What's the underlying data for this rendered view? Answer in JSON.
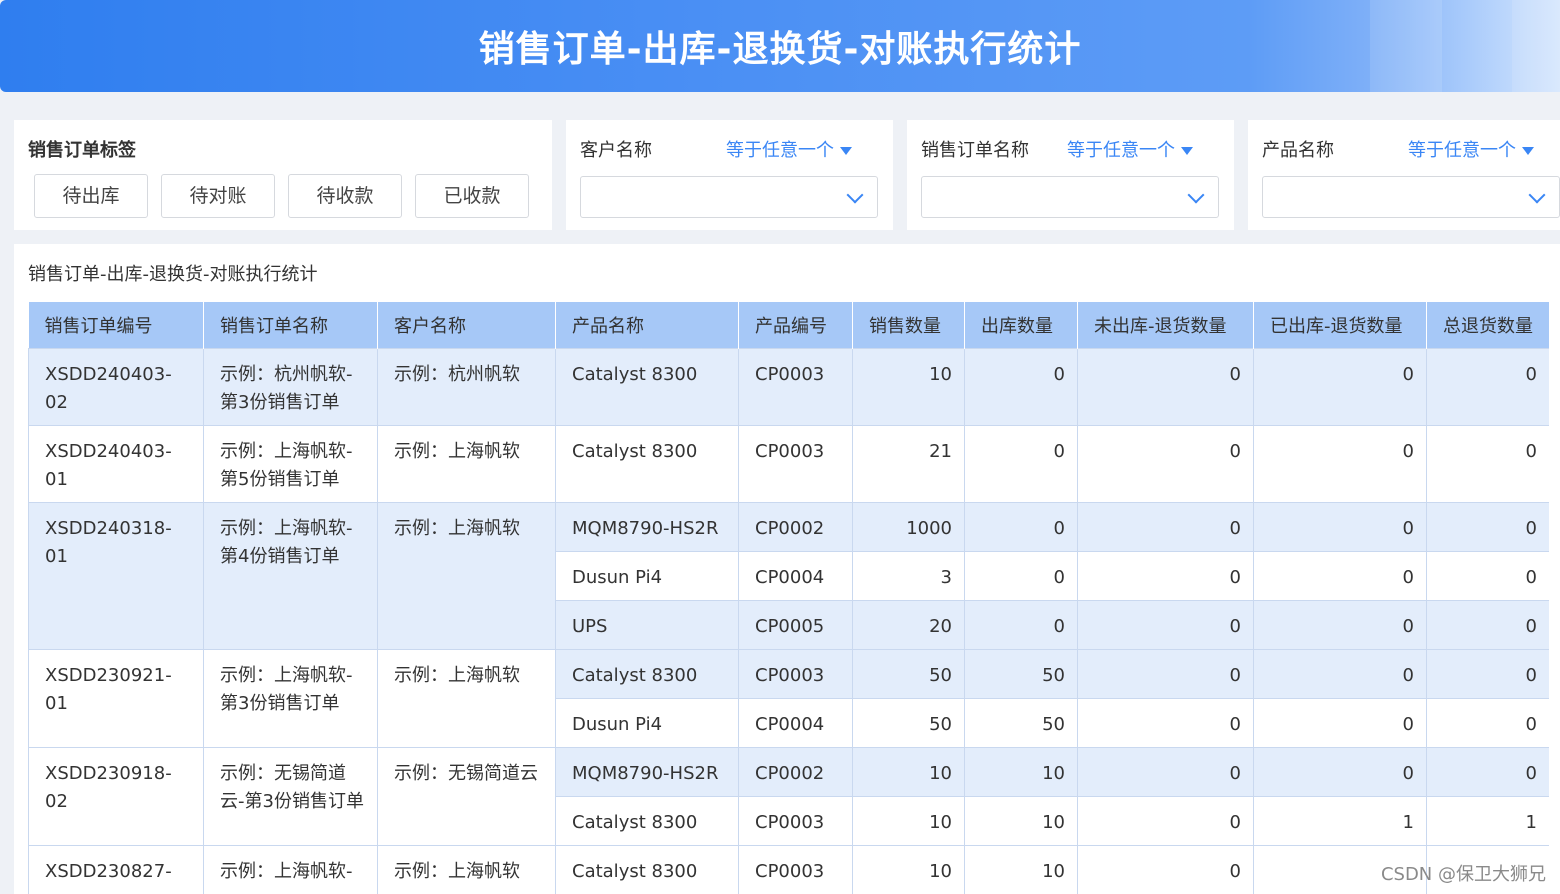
{
  "header": {
    "title": "销售订单-出库-退换货-对账执行统计"
  },
  "filters": {
    "tags": {
      "label": "销售订单标签",
      "buttons": [
        "待出库",
        "待对账",
        "待收款",
        "已收款"
      ]
    },
    "customer": {
      "label": "客户名称",
      "operator": "等于任意一个",
      "value": ""
    },
    "order_name": {
      "label": "销售订单名称",
      "operator": "等于任意一个",
      "value": ""
    },
    "product": {
      "label": "产品名称",
      "operator": "等于任意一个",
      "value": ""
    }
  },
  "table": {
    "caption": "销售订单-出库-退换货-对账执行统计",
    "columns": [
      "销售订单编号",
      "销售订单名称",
      "客户名称",
      "产品名称",
      "产品编号",
      "销售数量",
      "出库数量",
      "未出库-退货数量",
      "已出库-退货数量",
      "总退货数量"
    ],
    "orders": [
      {
        "order_no": "XSDD240403-02",
        "order_name": "示例：杭州帆软-第3份销售订单",
        "customer": "示例：杭州帆软",
        "items": [
          {
            "product": "Catalyst 8300",
            "code": "CP0003",
            "sales_qty": "10",
            "out_qty": "0",
            "unshipped_return": "0",
            "shipped_return": "0",
            "total_return": "0"
          }
        ]
      },
      {
        "order_no": "XSDD240403-01",
        "order_name": "示例：上海帆软-第5份销售订单",
        "customer": "示例：上海帆软",
        "items": [
          {
            "product": "Catalyst 8300",
            "code": "CP0003",
            "sales_qty": "21",
            "out_qty": "0",
            "unshipped_return": "0",
            "shipped_return": "0",
            "total_return": "0"
          }
        ]
      },
      {
        "order_no": "XSDD240318-01",
        "order_name": "示例：上海帆软-第4份销售订单",
        "customer": "示例：上海帆软",
        "items": [
          {
            "product": "MQM8790-HS2R",
            "code": "CP0002",
            "sales_qty": "1000",
            "out_qty": "0",
            "unshipped_return": "0",
            "shipped_return": "0",
            "total_return": "0"
          },
          {
            "product": "Dusun Pi4",
            "code": "CP0004",
            "sales_qty": "3",
            "out_qty": "0",
            "unshipped_return": "0",
            "shipped_return": "0",
            "total_return": "0"
          },
          {
            "product": "UPS",
            "code": "CP0005",
            "sales_qty": "20",
            "out_qty": "0",
            "unshipped_return": "0",
            "shipped_return": "0",
            "total_return": "0"
          }
        ]
      },
      {
        "order_no": "XSDD230921-01",
        "order_name": "示例：上海帆软-第3份销售订单",
        "customer": "示例：上海帆软",
        "items": [
          {
            "product": "Catalyst 8300",
            "code": "CP0003",
            "sales_qty": "50",
            "out_qty": "50",
            "unshipped_return": "0",
            "shipped_return": "0",
            "total_return": "0"
          },
          {
            "product": "Dusun Pi4",
            "code": "CP0004",
            "sales_qty": "50",
            "out_qty": "50",
            "unshipped_return": "0",
            "shipped_return": "0",
            "total_return": "0"
          }
        ]
      },
      {
        "order_no": "XSDD230918-02",
        "order_name": "示例：无锡简道云-第3份销售订单",
        "customer": "示例：无锡简道云",
        "items": [
          {
            "product": "MQM8790-HS2R",
            "code": "CP0002",
            "sales_qty": "10",
            "out_qty": "10",
            "unshipped_return": "0",
            "shipped_return": "0",
            "total_return": "0"
          },
          {
            "product": "Catalyst 8300",
            "code": "CP0003",
            "sales_qty": "10",
            "out_qty": "10",
            "unshipped_return": "0",
            "shipped_return": "1",
            "total_return": "1"
          }
        ]
      },
      {
        "order_no": "XSDD230827-",
        "order_name": "示例：上海帆软-",
        "customer": "示例：上海帆软",
        "items": [
          {
            "product": "Catalyst 8300",
            "code": "CP0003",
            "sales_qty": "10",
            "out_qty": "10",
            "unshipped_return": "0",
            "shipped_return": "",
            "total_return": ""
          }
        ]
      }
    ]
  },
  "watermark": "CSDN @保卫大狮兄"
}
